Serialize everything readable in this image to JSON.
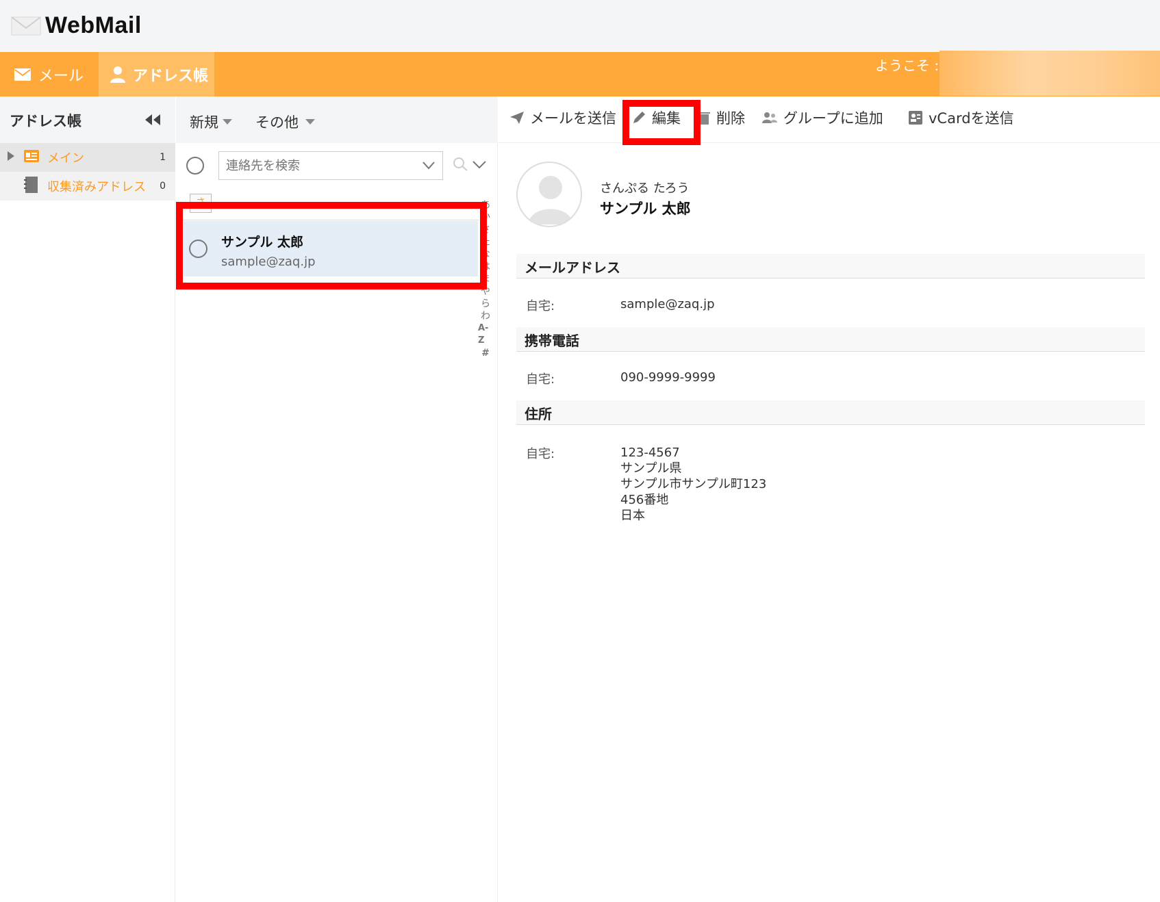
{
  "app": {
    "title": "WebMail"
  },
  "nav": {
    "mail_label": "メール",
    "addressbook_label": "アドレス帳",
    "welcome": "ようこそ :"
  },
  "sidebar": {
    "title": "アドレス帳",
    "folders": [
      {
        "label": "メイン",
        "count": "1"
      },
      {
        "label": "収集済みアドレス",
        "count": "0"
      }
    ]
  },
  "list": {
    "new_label": "新規",
    "more_label": "その他",
    "search_placeholder": "連絡先を検索",
    "group_letter": "さ",
    "contacts": [
      {
        "name": "サンプル 太郎",
        "email": "sample@zaq.jp"
      }
    ],
    "alpha_index": [
      "あ",
      "か",
      "さ",
      "た",
      "な",
      "は",
      "ま",
      "や",
      "ら",
      "わ",
      "A-Z",
      "#"
    ]
  },
  "toolbar": {
    "send_label": "メールを送信",
    "edit_label": "編集",
    "delete_label": "削除",
    "group_label": "グループに追加",
    "vcard_label": "vCardを送信"
  },
  "contact": {
    "reading": "さんぷる たろう",
    "name": "サンプル 太郎",
    "sections": {
      "email": {
        "title": "メールアドレス",
        "label": "自宅:",
        "value": "sample@zaq.jp"
      },
      "mobile": {
        "title": "携帯電話",
        "label": "自宅:",
        "value": "090-9999-9999"
      },
      "address": {
        "title": "住所",
        "label": "自宅:",
        "lines": [
          "123-4567",
          "サンプル県",
          "サンプル市サンプル町123",
          "456番地",
          "日本"
        ]
      }
    }
  },
  "colors": {
    "accent": "#ffa93a",
    "accent_active": "#ffbe63",
    "highlight": "#ff0000",
    "selected_row": "#e5eef6"
  }
}
